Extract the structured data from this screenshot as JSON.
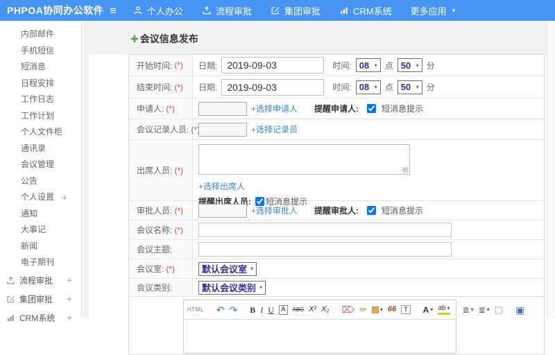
{
  "icons": {
    "hamburger": "≡",
    "caret": "▾",
    "plus_green": "✚",
    "expand": "+",
    "select_caret": "▾"
  },
  "topbar": {
    "brand": "PHPOA协同办公软件",
    "menu": [
      {
        "label": "个人办公"
      },
      {
        "label": "流程审批"
      },
      {
        "label": "集团审批"
      },
      {
        "label": "CRM系统"
      },
      {
        "label": "更多应用"
      }
    ]
  },
  "sidebar": {
    "items": [
      "内部邮件",
      "手机短信",
      "短消息",
      "日程安排",
      "工作日志",
      "工作计划",
      "个人文件柜",
      "通讯录",
      "会议管理",
      "公告",
      "个人设置",
      "通知",
      "大事记",
      "新闻",
      "电子期刊"
    ],
    "sections": [
      "流程审批",
      "集团审批",
      "CRM系统"
    ]
  },
  "main": {
    "page_title": "会议信息发布",
    "form": {
      "start": {
        "label": "开始时间:",
        "req": "(*)",
        "date_label": "日期:",
        "date": "2019-09-03",
        "time_label": "时间:",
        "hour": "08",
        "hour_unit": "点",
        "minute": "50",
        "minute_unit": "分"
      },
      "end": {
        "label": "结束时间:",
        "req": "(*)",
        "date_label": "日期:",
        "date": "2019-09-03",
        "time_label": "时间:",
        "hour": "08",
        "hour_unit": "点",
        "minute": "50",
        "minute_unit": "分"
      },
      "applicant": {
        "label": "申请人:",
        "req": "(*)",
        "link": "+选择申请人",
        "remind": "提醒申请人:",
        "sms": "短消息提示"
      },
      "recorder": {
        "label": "会议记录人员:",
        "req": "(*)",
        "link": "+选择记录员"
      },
      "attendee": {
        "label": "出席人员:",
        "req": "(*)",
        "link": "+选择出席人",
        "remind": "提醒出席人员:",
        "sms": "短消息提示"
      },
      "approver": {
        "label": "审批人员:",
        "req": "(*)",
        "link": "+选择审批人",
        "remind": "提醒审批人:",
        "sms": "短消息提示"
      },
      "name": {
        "label": "会议名称:",
        "req": "(*)"
      },
      "subject": {
        "label": "会议主题:"
      },
      "room": {
        "label": "会议室:",
        "req": "(*)",
        "value": "默认会议室"
      },
      "category": {
        "label": "会议类别:",
        "value": "默认会议类别"
      }
    },
    "editor": {
      "html_btn": "HTML",
      "undo": "↶",
      "redo": "↷",
      "bold": "B",
      "italic": "I",
      "underline": "U",
      "font_box": "A",
      "strike": "ABC",
      "sup": "X²",
      "sub": "X₂",
      "eraser": "⌦",
      "brush": "✏",
      "quote": "66",
      "font_t": "T",
      "font_color": "A",
      "highlight": "ab",
      "list": "≣",
      "page": "▢",
      "screen": "▣"
    }
  }
}
